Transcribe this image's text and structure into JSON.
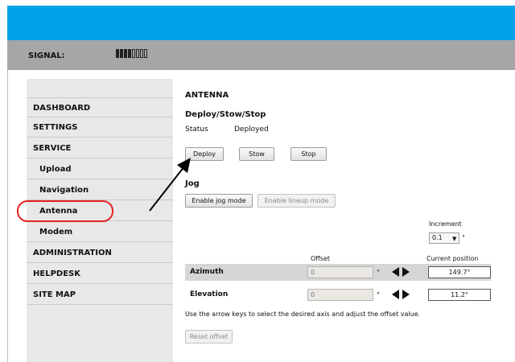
{
  "signal": {
    "label": "SIGNAL:",
    "bars_total": 8,
    "bars_filled": 4
  },
  "sidebar": {
    "items": [
      {
        "label": "DASHBOARD",
        "level": 0
      },
      {
        "label": "SETTINGS",
        "level": 0
      },
      {
        "label": "SERVICE",
        "level": 0
      },
      {
        "label": "Upload",
        "level": 1
      },
      {
        "label": "Navigation",
        "level": 1
      },
      {
        "label": "Antenna",
        "level": 1,
        "highlighted": true
      },
      {
        "label": "Modem",
        "level": 1
      },
      {
        "label": "ADMINISTRATION",
        "level": 0
      },
      {
        "label": "HELPDESK",
        "level": 0
      },
      {
        "label": "SITE MAP",
        "level": 0
      }
    ]
  },
  "main": {
    "title": "ANTENNA",
    "deploy_section": {
      "heading": "Deploy/Stow/Stop",
      "status_label": "Status",
      "status_value": "Deployed",
      "buttons": {
        "deploy": "Deploy",
        "stow": "Stow",
        "stop": "Stop"
      }
    },
    "jog_section": {
      "heading": "Jog",
      "enable_jog_label": "Enable jog mode",
      "enable_lineup_label": "Enable lineup mode",
      "increment_label": "Increment",
      "increment_value": "0.1",
      "degree_symbol": "°",
      "offset_header": "Offset",
      "current_header": "Current position",
      "rows": [
        {
          "label": "Azimuth",
          "offset_placeholder": "0",
          "current": "149.7°"
        },
        {
          "label": "Elevation",
          "offset_placeholder": "0",
          "current": "11.2°"
        }
      ],
      "instruction": "Use the arrow keys to select the desired axis and adjust the offset value.",
      "reset_label": "Reset offset"
    }
  },
  "colors": {
    "header_bar": "#00a2e8",
    "signal_bar": "#a6a6a6",
    "sidebar_bg": "#e8e8e8",
    "highlight": "#e32222"
  },
  "icons": {
    "signal_meter": "signal-strength-icon",
    "increase": "arrow-right-icon",
    "decrease": "arrow-left-icon",
    "dropdown": "chevron-down-icon"
  }
}
